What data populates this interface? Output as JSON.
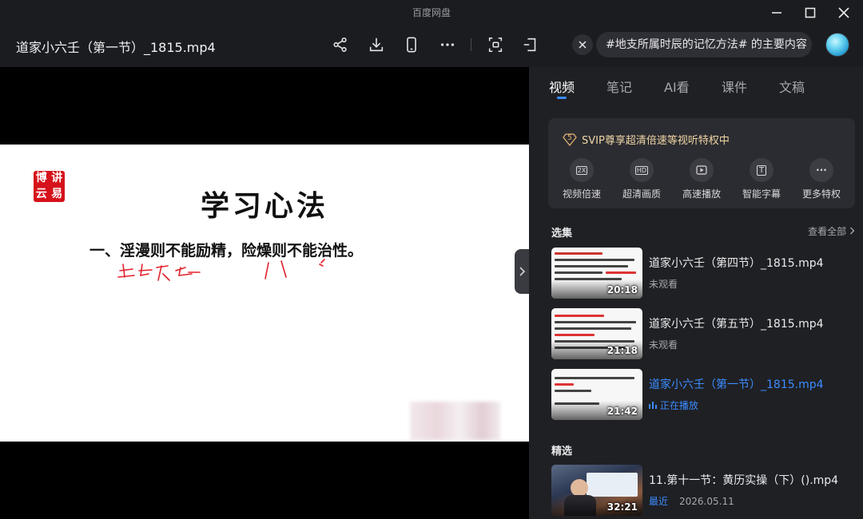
{
  "window": {
    "app_title": "百度网盘"
  },
  "header": {
    "file_title": "道家小六壬（第一节）_1815.mp4",
    "search_text": "#地支所属时辰的记忆方法# 的主要内容"
  },
  "slide": {
    "seal_chars": [
      "博",
      "讲",
      "云",
      "易"
    ],
    "title": "学习心法",
    "line1": "一、淫漫则不能励精，险燥则不能治性。"
  },
  "panel": {
    "tabs": [
      {
        "label": "视频"
      },
      {
        "label": "笔记"
      },
      {
        "label": "AI看"
      },
      {
        "label": "课件"
      },
      {
        "label": "文稿"
      }
    ],
    "svip": {
      "badge": "5",
      "headline": "SVIP尊享超清倍速等视听特权中",
      "features": [
        {
          "label": "视频倍速",
          "icon_text": "2X"
        },
        {
          "label": "超清画质",
          "icon_text": "HD"
        },
        {
          "label": "高速播放",
          "icon_text": ""
        },
        {
          "label": "智能字幕",
          "icon_text": "T"
        },
        {
          "label": "更多特权",
          "icon_text": "···"
        }
      ]
    },
    "episodes_title": "选集",
    "see_all": "查看全部",
    "episodes": [
      {
        "title": "道家小六壬（第四节）_1815.mp4",
        "status": "未观看",
        "duration": "20:18"
      },
      {
        "title": "道家小六壬（第五节）_1815.mp4",
        "status": "未观看",
        "duration": "21:18"
      },
      {
        "title": "道家小六壬（第一节）_1815.mp4",
        "status": "正在播放",
        "duration": "21:42"
      }
    ],
    "featured_title": "精选",
    "featured": [
      {
        "title": "11.第十一节：黄历实操（下）().mp4",
        "tag": "最近",
        "date": "2026.05.11",
        "duration": "32:21"
      }
    ]
  }
}
